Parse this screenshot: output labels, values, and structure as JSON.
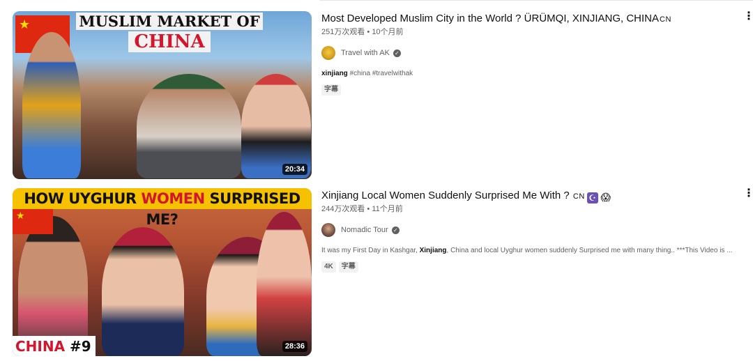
{
  "videos": [
    {
      "title": "Most Developed Muslim City in the World ? ÜRÜMQI, XINJIANG, CHINA",
      "title_flag": "CN",
      "meta": "251万次观看 • 10个月前",
      "channel": "Travel with AK",
      "desc_b": "xinjiang",
      "desc_rest": " #china #travelwithak",
      "badges": [
        "字幕"
      ],
      "duration": "20:34",
      "thumb": {
        "line1": "MUSLIM MARKET OF",
        "line2": "CHINA",
        "flag": "★"
      },
      "menu_icon": "⋮"
    },
    {
      "title": "Xinjiang Local Women Suddenly Surprised Me With ?",
      "title_flag": "CN",
      "emoji1": "☪",
      "emoji2": "😱",
      "meta": "244万次观看 • 11个月前",
      "channel": "Nomadic Tour",
      "desc_a": "It was my First Day in Kashgar, ",
      "desc_b": "Xinjiang",
      "desc_rest": ", China and local Uyghur women suddenly Surprised me with many thing.. ***This Video is ...",
      "badges": [
        "4K",
        "字幕"
      ],
      "duration": "28:36",
      "thumb": {
        "h1": "HOW UYGHUR ",
        "h2": "WOMEN",
        "h3": " SURPRISED ME?",
        "b1": "CHINA",
        "b2": " #9",
        "flag": "★"
      },
      "menu_icon": "⋮"
    }
  ],
  "icons": {
    "verified": "✓"
  },
  "colors": {
    "accent_red": "#d3162b",
    "banner_yellow": "#f6c200",
    "meta_gray": "#606060"
  }
}
